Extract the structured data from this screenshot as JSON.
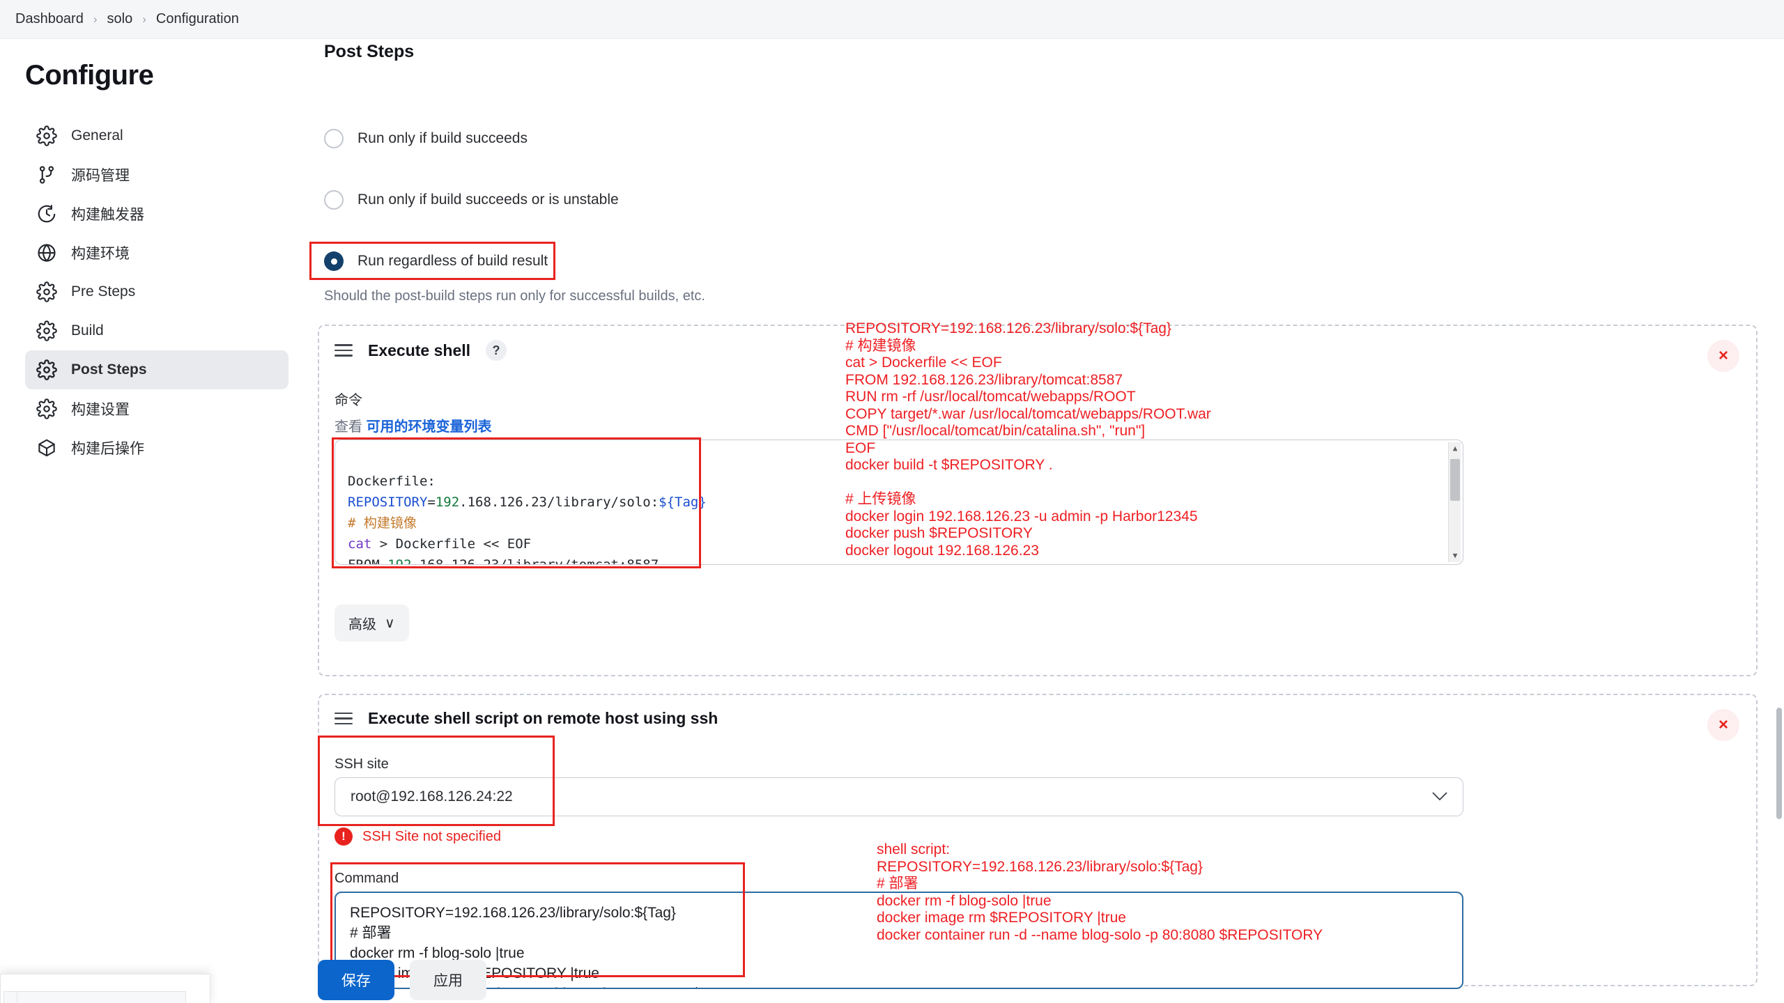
{
  "breadcrumb": {
    "items": [
      "Dashboard",
      "solo",
      "Configuration"
    ],
    "separator": "›"
  },
  "sidebar": {
    "title": "Configure",
    "items": [
      {
        "label": "General",
        "icon": "gear-icon",
        "active": false
      },
      {
        "label": "源码管理",
        "icon": "branch-icon",
        "active": false
      },
      {
        "label": "构建触发器",
        "icon": "clock-icon",
        "active": false
      },
      {
        "label": "构建环境",
        "icon": "globe-icon",
        "active": false
      },
      {
        "label": "Pre Steps",
        "icon": "gear-icon",
        "active": false
      },
      {
        "label": "Build",
        "icon": "gear-icon",
        "active": false
      },
      {
        "label": "Post Steps",
        "icon": "gear-icon",
        "active": true
      },
      {
        "label": "构建设置",
        "icon": "gear-icon",
        "active": false
      },
      {
        "label": "构建后操作",
        "icon": "package-icon",
        "active": false
      }
    ]
  },
  "main": {
    "section_title": "Post Steps",
    "radios": [
      {
        "label": "Run only if build succeeds",
        "checked": false
      },
      {
        "label": "Run only if build succeeds or is unstable",
        "checked": false
      },
      {
        "label": "Run regardless of build result",
        "checked": true
      }
    ],
    "radio_hint": "Should the post-build steps run only for successful builds, etc.",
    "execute_shell": {
      "title": "Execute shell",
      "help_badge": "?",
      "close_label": "×",
      "command_label": "命令",
      "env_prefix": "查看",
      "env_link": "可用的环境变量列表",
      "advanced_label": "高级",
      "advanced_chevron": "∨",
      "script_lines": [
        {
          "plain": "Dockerfile:"
        },
        {
          "var": "REPOSITORY",
          "eq": "=",
          "num": "192",
          "rest": ".168.126.23/library/solo:",
          "dollar": "${Tag}"
        },
        {
          "comment": "# 构建镜像"
        },
        {
          "kw": "cat",
          "tail": " > Dockerfile << EOF"
        },
        {
          "pre": "FROM ",
          "num2": "192",
          "tail2": ".168.126.23/library/tomcat:8587"
        },
        {
          "clipped": "RUN rm -rf /usr/local/tomcat/webapps/ROOT"
        }
      ]
    },
    "shell_annotation": "REPOSITORY=192.168.126.23/library/solo:${Tag}\n# 构建镜像\ncat > Dockerfile << EOF\nFROM 192.168.126.23/library/tomcat:8587\nRUN rm -rf /usr/local/tomcat/webapps/ROOT\nCOPY target/*.war /usr/local/tomcat/webapps/ROOT.war\nCMD [\"/usr/local/tomcat/bin/catalina.sh\", \"run\"]\nEOF\ndocker build -t $REPOSITORY .\n\n# 上传镜像\ndocker login 192.168.126.23 -u admin -p Harbor12345\ndocker push $REPOSITORY\ndocker logout 192.168.126.23",
    "ssh_step": {
      "title": "Execute shell script on remote host using ssh",
      "close_label": "×",
      "ssh_site_label": "SSH site",
      "ssh_site_value": "root@192.168.126.24:22",
      "ssh_site_chevron": "⌄",
      "error_icon": "!",
      "error_text": "SSH Site not specified",
      "command_label": "Command",
      "command_value": "REPOSITORY=192.168.126.23/library/solo:${Tag}\n# 部署\ndocker rm -f blog-solo |true\ndocker image rm $REPOSITORY |true\ndocker container run -d --name blog-solo -p 80:8080 $REPOSITORY"
    },
    "ssh_annotation": "shell script:\nREPOSITORY=192.168.126.23/library/solo:${Tag}\n# 部署\ndocker rm -f blog-solo |true\ndocker image rm $REPOSITORY |true\ndocker container run -d --name blog-solo -p 80:8080 $REPOSITORY"
  },
  "footer": {
    "save_label": "保存",
    "apply_label": "应用"
  },
  "colors": {
    "accent": "#0b65cb",
    "annotation_red": "#ed2024",
    "box_red": "#e8231f",
    "radio_selected": "#13416b",
    "link_blue": "#1a63d8",
    "active_bg": "#e9eaee"
  }
}
